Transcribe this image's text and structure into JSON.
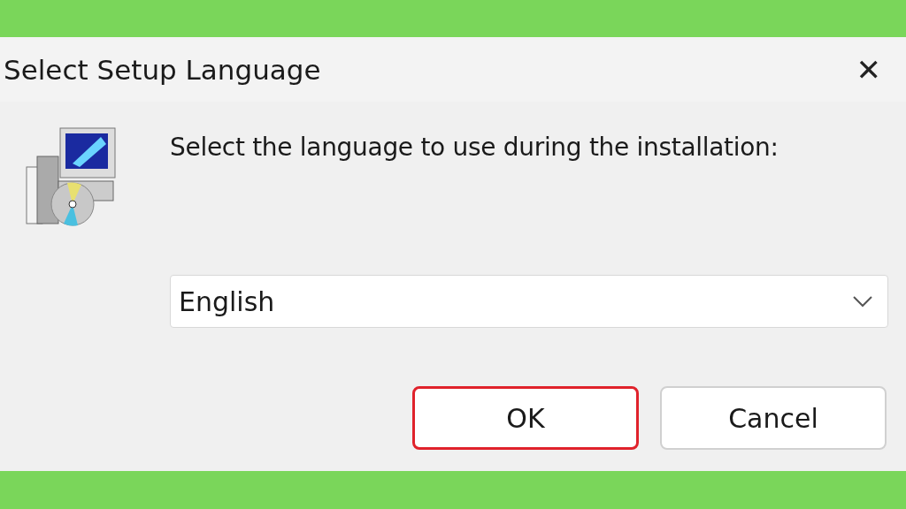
{
  "window": {
    "title": "Select Setup Language",
    "close": "✕"
  },
  "message": "Select the language to use during the installation:",
  "language_dropdown": {
    "value": "English"
  },
  "buttons": [
    {
      "label": "OK",
      "highlighted": true
    },
    {
      "label": "Cancel",
      "highlighted": false
    }
  ]
}
